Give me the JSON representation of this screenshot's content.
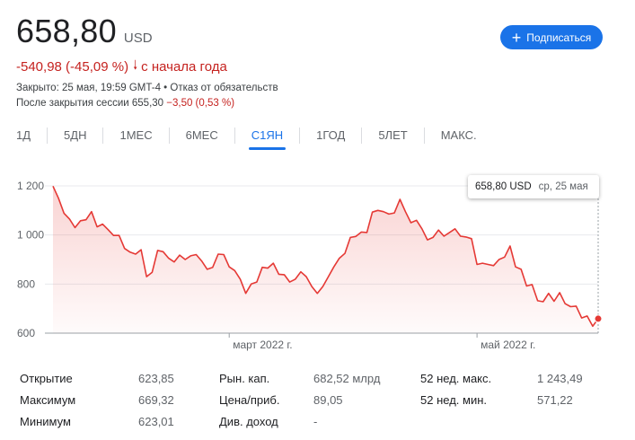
{
  "quote": {
    "price": "658,80",
    "currency": "USD",
    "change": "-540,98 (-45,09 %)",
    "change_arrow": "🡓",
    "change_period": "с начала года",
    "closed_line": "Закрыто: 25 мая, 19:59 GMT-4 • Отказ от обязательств",
    "after_hours_label": "После закрытия сессии 655,30",
    "after_hours_change": "−3,50 (0,53 %)"
  },
  "subscribe": {
    "icon": "plus-icon",
    "label": "Подписаться"
  },
  "tabs": [
    {
      "label": "1Д",
      "active": false
    },
    {
      "label": "5ДН",
      "active": false
    },
    {
      "label": "1МЕС",
      "active": false
    },
    {
      "label": "6МЕС",
      "active": false
    },
    {
      "label": "С1ЯН",
      "active": true
    },
    {
      "label": "1ГОД",
      "active": false
    },
    {
      "label": "5ЛЕТ",
      "active": false
    },
    {
      "label": "МАКС.",
      "active": false
    }
  ],
  "tooltip": {
    "value": "658,80 USD",
    "date": "ср, 25 мая"
  },
  "colors": {
    "line": "#e53935",
    "accent": "#1a73e8",
    "negative": "#c5221f"
  },
  "chart_data": {
    "type": "area",
    "yticks": [
      "1 200",
      "1 000",
      "800",
      "600"
    ],
    "ytick_values": [
      1200,
      1000,
      800,
      600
    ],
    "xticks": [
      "март 2022 г.",
      "май 2022 г."
    ],
    "xtick_index": [
      32,
      77
    ],
    "ylim": [
      600,
      1200
    ],
    "values": [
      1199,
      1150,
      1088,
      1065,
      1030,
      1058,
      1062,
      1095,
      1033,
      1044,
      1022,
      998,
      998,
      945,
      930,
      922,
      940,
      830,
      848,
      937,
      932,
      905,
      890,
      918,
      900,
      915,
      920,
      894,
      860,
      868,
      922,
      920,
      870,
      855,
      820,
      762,
      800,
      808,
      868,
      865,
      885,
      840,
      838,
      808,
      820,
      850,
      830,
      790,
      762,
      790,
      830,
      870,
      905,
      925,
      990,
      994,
      1012,
      1010,
      1093,
      1100,
      1095,
      1085,
      1090,
      1145,
      1095,
      1050,
      1060,
      1025,
      980,
      990,
      1020,
      995,
      1010,
      1025,
      995,
      992,
      985,
      880,
      885,
      880,
      875,
      900,
      910,
      955,
      870,
      860,
      792,
      798,
      732,
      728,
      762,
      730,
      765,
      720,
      708,
      710,
      662,
      670,
      628,
      658.8
    ],
    "current": 658.8
  },
  "stats": [
    {
      "label": "Открытие",
      "value": "623,85"
    },
    {
      "label": "Максимум",
      "value": "669,32"
    },
    {
      "label": "Минимум",
      "value": "623,01"
    },
    {
      "label": "Рын. кап.",
      "value": "682,52 млрд"
    },
    {
      "label": "Цена/приб.",
      "value": "89,05"
    },
    {
      "label": "Див. доход",
      "value": "-"
    },
    {
      "label": "52 нед. макс.",
      "value": "1 243,49"
    },
    {
      "label": "52 нед. мин.",
      "value": "571,22"
    }
  ]
}
